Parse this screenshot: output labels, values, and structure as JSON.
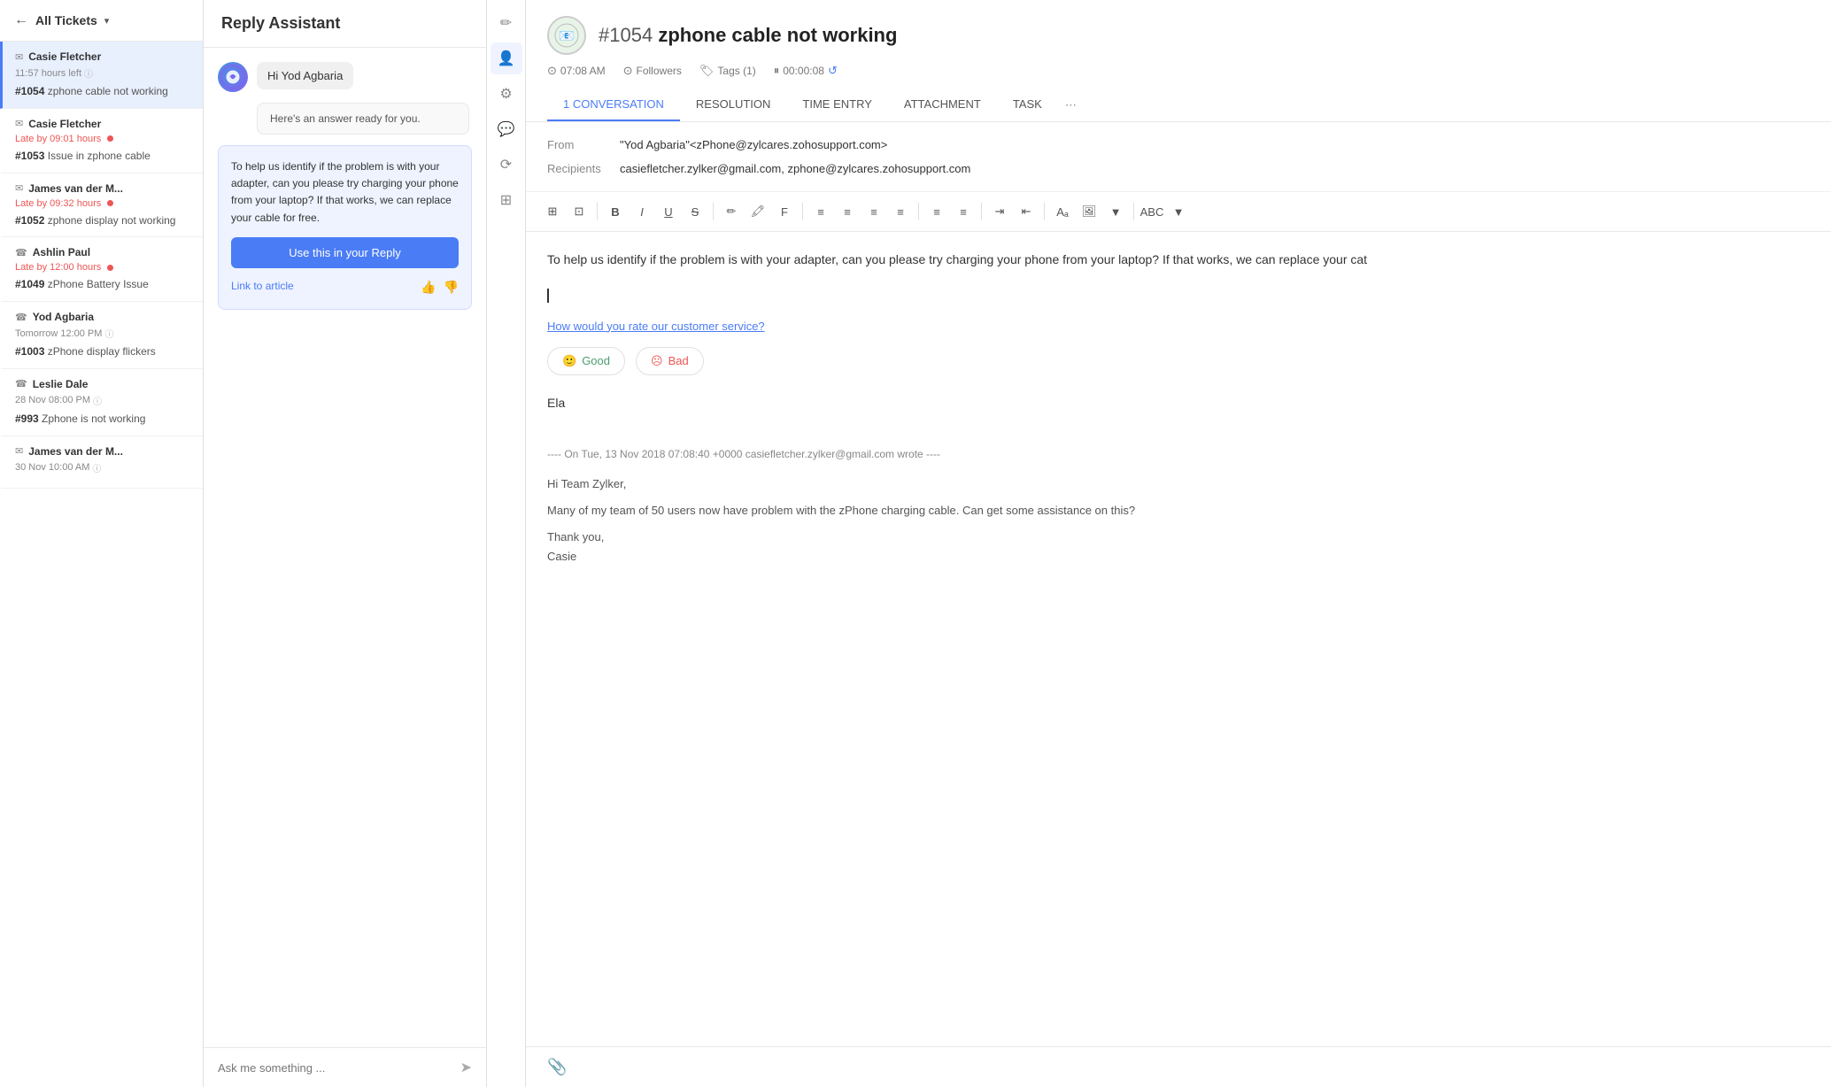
{
  "sidebar": {
    "header": {
      "back_label": "←",
      "title": "All Tickets",
      "dropdown": "▾"
    },
    "tickets": [
      {
        "icon": "✉",
        "author": "Casie Fletcher",
        "time": "11:57 hours left",
        "time_type": "normal",
        "number": "#1054",
        "subject": "zphone cable not working",
        "active": true
      },
      {
        "icon": "✉",
        "author": "Casie Fletcher",
        "time": "Late by 09:01 hours",
        "time_type": "late",
        "number": "#1053",
        "subject": "Issue in zphone cable",
        "active": false
      },
      {
        "icon": "✉",
        "author": "James van der M...",
        "time": "Late by 09:32 hours",
        "time_type": "late",
        "number": "#1052",
        "subject": "zphone display not working",
        "active": false
      },
      {
        "icon": "☎",
        "author": "Ashlin Paul",
        "time": "Late by 12:00 hours",
        "time_type": "late",
        "number": "#1049",
        "subject": "zPhone Battery Issue",
        "active": false
      },
      {
        "icon": "☎",
        "author": "Yod Agbaria",
        "time": "Tomorrow 12:00 PM",
        "time_type": "normal",
        "number": "#1003",
        "subject": "zPhone display flickers",
        "active": false
      },
      {
        "icon": "☎",
        "author": "Leslie Dale",
        "time": "28 Nov 08:00 PM",
        "time_type": "normal",
        "number": "#993",
        "subject": "Zphone is not working",
        "active": false
      },
      {
        "icon": "✉",
        "author": "James van der M...",
        "time": "30 Nov 10:00 AM",
        "time_type": "normal",
        "number": "",
        "subject": "",
        "active": false
      }
    ]
  },
  "reply_assistant": {
    "title": "Reply Assistant",
    "bot_greeting": "Hi Yod Agbaria",
    "system_message": "Here's an answer ready for you.",
    "answer_text": "To help us identify if the problem is with your adapter, can you please try charging your phone from your laptop? If that works, we can replace your cable for free.",
    "use_reply_btn": "Use this in your Reply",
    "link_article": "Link to article",
    "input_placeholder": "Ask me something ..."
  },
  "ticket": {
    "number": "#1054",
    "title": "zphone cable not working",
    "time": "07:08 AM",
    "followers": "Followers",
    "tags": "Tags (1)",
    "timer": "00:00:08"
  },
  "tabs": [
    {
      "label": "1 CONVERSATION",
      "badge": "",
      "active": true
    },
    {
      "label": "RESOLUTION",
      "badge": "",
      "active": false
    },
    {
      "label": "TIME ENTRY",
      "badge": "",
      "active": false
    },
    {
      "label": "ATTACHMENT",
      "badge": "",
      "active": false
    },
    {
      "label": "TASK",
      "badge": "",
      "active": false
    }
  ],
  "email": {
    "from_label": "From",
    "from_value": "\"Yod Agbaria\"<zPhone@zylcares.zohosupport.com>",
    "recipients_label": "Recipients",
    "recipients_value": "casiefletcher.zylker@gmail.com, zphone@zylcares.zohosupport.com"
  },
  "editor": {
    "main_text": "To help us identify if the problem is with your adapter, can you please try charging your phone from your laptop? If that works, we can replace your cat",
    "rating_link": "How would you rate our customer service?",
    "good_label": "Good",
    "bad_label": "Bad",
    "signature": "Ela",
    "divider": "---- On Tue, 13 Nov 2018 07:08:40 +0000 casiefletcher.zylker@gmail.com wrote ----",
    "quoted_line1": "Hi Team Zylker,",
    "quoted_line2": "Many of my team of 50 users now have problem with the zPhone charging cable. Can get some assistance on this?",
    "quoted_line3": "Thank you,",
    "quoted_line4": "Casie"
  },
  "toolbar_buttons": [
    "⊞",
    "⊡",
    "B",
    "I",
    "U",
    "S",
    "✏",
    "🖍",
    "F",
    "≡",
    "≡",
    "≡",
    "≡",
    "≡",
    "≡",
    "⋮",
    "⊞",
    "🖼",
    "▼",
    "ABC",
    "▼"
  ],
  "icon_sidebar": [
    {
      "name": "edit-icon",
      "symbol": "✏",
      "active": false
    },
    {
      "name": "user-icon",
      "symbol": "👤",
      "active": true
    },
    {
      "name": "settings-icon",
      "symbol": "⚙",
      "active": false
    },
    {
      "name": "chat-icon",
      "symbol": "💬",
      "active": false
    },
    {
      "name": "history-icon",
      "symbol": "⟳",
      "active": false
    },
    {
      "name": "layers-icon",
      "symbol": "⊞",
      "active": false
    }
  ]
}
